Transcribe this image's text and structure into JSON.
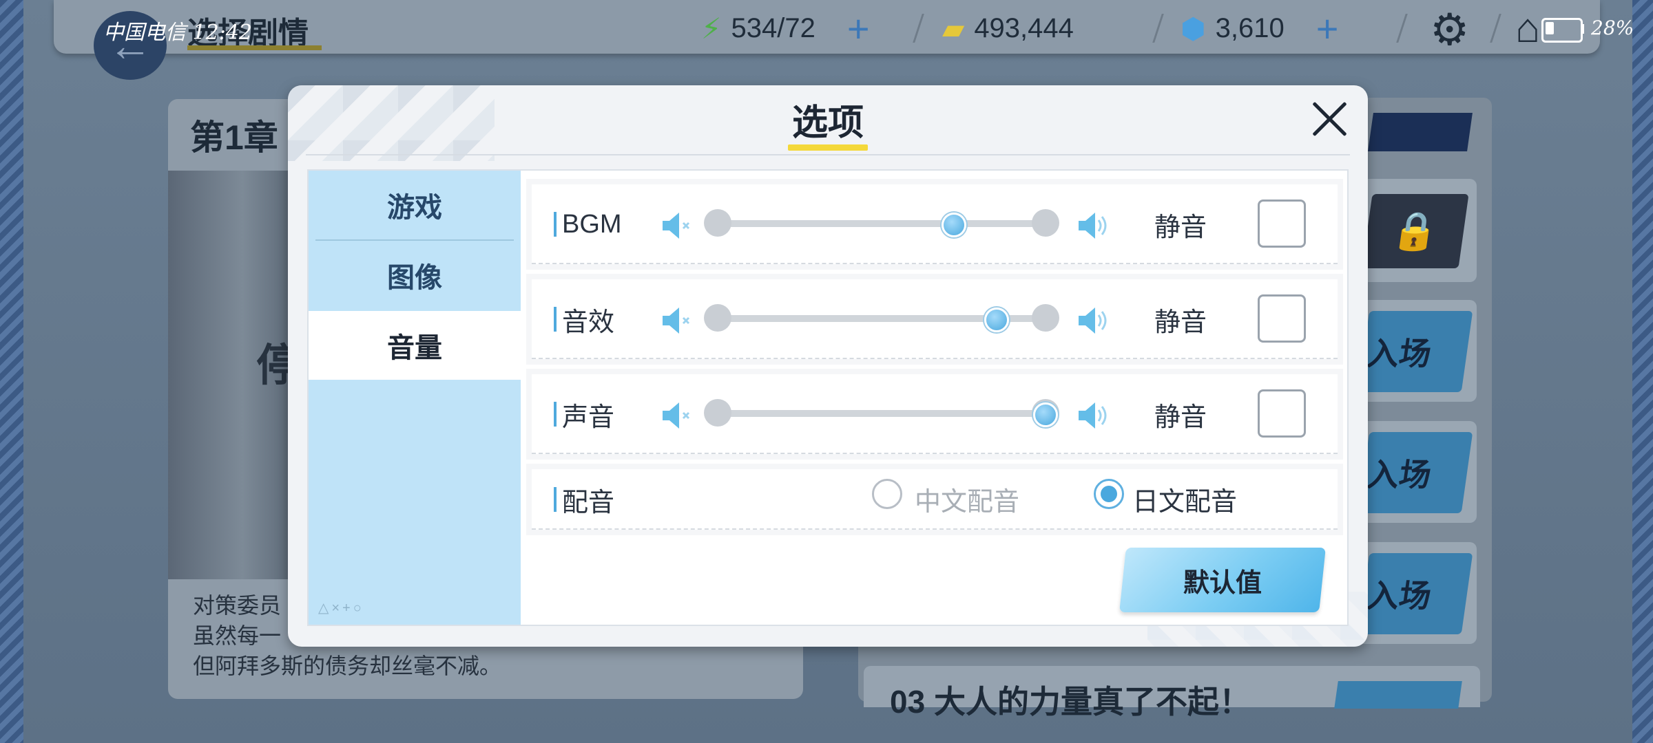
{
  "status": {
    "carrier": "中国电信 12:42",
    "battery": "28%"
  },
  "header": {
    "title": "选择剧情",
    "resources": [
      {
        "icon": "energy-icon",
        "value": "534/72"
      },
      {
        "icon": "credit-card-icon",
        "value": "493,444"
      },
      {
        "icon": "crystal-icon",
        "value": "3,610"
      }
    ]
  },
  "background": {
    "chapter_title": "第1章",
    "chapter_image_text": "停",
    "chapter_description": [
      "对策委员",
      "虽然每一",
      "但阿拜多斯的债务却丝毫不减。"
    ],
    "entry_label": "入场",
    "row03_text": "03  大人的力量真了不起！"
  },
  "dialog": {
    "title": "选项",
    "tabs": [
      {
        "label": "游戏",
        "active": false
      },
      {
        "label": "图像",
        "active": false
      },
      {
        "label": "音量",
        "active": true
      }
    ],
    "sidebar_footer": "△×+○",
    "mute_label": "静音",
    "volume_rows": [
      {
        "label": "BGM",
        "level": 0.72,
        "muted": false
      },
      {
        "label": "音效",
        "level": 0.85,
        "muted": false
      },
      {
        "label": "声音",
        "level": 1.0,
        "muted": false
      }
    ],
    "voice": {
      "label": "配音",
      "options": [
        {
          "label": "中文配音",
          "selected": false
        },
        {
          "label": "日文配音",
          "selected": true
        }
      ]
    },
    "default_button": "默认值"
  },
  "colors": {
    "accent": "#4aa8de",
    "tab_bg": "#bfe3f8",
    "title_underline": "#f4d83a"
  }
}
